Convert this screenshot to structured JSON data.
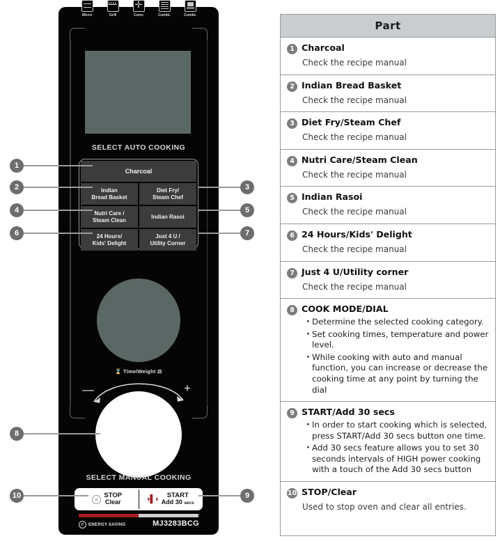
{
  "panel": {
    "mode_icons": [
      {
        "label": "Micro",
        "icon": "microwave-icon"
      },
      {
        "label": "Grill",
        "icon": "grill-icon"
      },
      {
        "label": "Conv.",
        "icon": "convection-icon"
      },
      {
        "label": "Combi.",
        "icon": "combi-1-icon"
      },
      {
        "label": "Combi.",
        "icon": "combi-2-icon"
      }
    ],
    "auto_cooking_title": "SELECT AUTO COOKING",
    "manual_cooking_title": "SELECT MANUAL COOKING",
    "buttons": {
      "charcoal": "Charcoal",
      "indian_bread_basket": "Indian\nBread Basket",
      "diet_fry_steam_chef": "Diet Fry/\nSteam Chef",
      "nutri_care_steam_clean": "Nutri Care /\nSteam Clean",
      "indian_rasoi": "Indian Rasoi",
      "kids_delight": "24 Hours/\nKids' Delight",
      "just4u": "Just 4 U /\nUtility Corner"
    },
    "dial": {
      "time_weight_label": "Time/Weight",
      "minus": "—",
      "plus": "+"
    },
    "stop_button": {
      "line1": "STOP",
      "line2": "Clear",
      "icon": "eco-icon"
    },
    "start_button": {
      "line1": "START",
      "line2": "Add 30 ",
      "line2_sub": "secs",
      "icon": "start-burst-icon"
    },
    "energy_saving_label": "ENERGY SAVING",
    "model_number": "MJ3283BCG",
    "callouts": [
      {
        "n": "1",
        "side": "left"
      },
      {
        "n": "2",
        "side": "left"
      },
      {
        "n": "3",
        "side": "right"
      },
      {
        "n": "4",
        "side": "left"
      },
      {
        "n": "5",
        "side": "right"
      },
      {
        "n": "6",
        "side": "left"
      },
      {
        "n": "7",
        "side": "right"
      },
      {
        "n": "8",
        "side": "left"
      },
      {
        "n": "9",
        "side": "right"
      },
      {
        "n": "10",
        "side": "left"
      }
    ]
  },
  "table": {
    "header": "Part",
    "rows": [
      {
        "num": "1",
        "title": "Charcoal",
        "sub": "Check the recipe manual",
        "bullets": []
      },
      {
        "num": "2",
        "title": "Indian Bread Basket",
        "sub": "Check the recipe manual",
        "bullets": []
      },
      {
        "num": "3",
        "title": "Diet Fry/Steam Chef",
        "sub": "Check the recipe manual",
        "bullets": []
      },
      {
        "num": "4",
        "title": "Nutri Care/Steam Clean",
        "sub": "Check the recipe manual",
        "bullets": []
      },
      {
        "num": "5",
        "title": "Indian Rasoi",
        "sub": "Check the recipe manual",
        "bullets": []
      },
      {
        "num": "6",
        "title": "24 Hours/Kids' Delight",
        "sub": "Check the recipe manual",
        "bullets": []
      },
      {
        "num": "7",
        "title": "Just 4 U/Utility corner",
        "sub": "Check the recipe manual",
        "bullets": []
      },
      {
        "num": "8",
        "title": "COOK MODE/DIAL",
        "sub": "",
        "bullets": [
          "Determine the selected cooking category.",
          "Set cooking times, temperature and power level.",
          "While cooking with auto and manual function, you can increase or decrease the cooking time at any point by turning the dial"
        ]
      },
      {
        "num": "9",
        "title": "START/Add 30 secs",
        "sub": "",
        "bullets": [
          "In order to start cooking which is selected, press START/Add 30 secs  button one time.",
          "Add 30 secs feature allows you to set 30 seconds intervals of HIGH power cooking with a touch of the Add 30 secs button"
        ]
      },
      {
        "num": "10",
        "title": "STOP/Clear",
        "sub": "Used to stop oven and clear all entries.",
        "bullets": []
      }
    ]
  },
  "colors": {
    "panel_black": "#050505",
    "display_green": "#5b6764",
    "button_grey": "#3c3c3c",
    "table_header": "#c9cdcf",
    "accent_red": "#a81d22"
  }
}
